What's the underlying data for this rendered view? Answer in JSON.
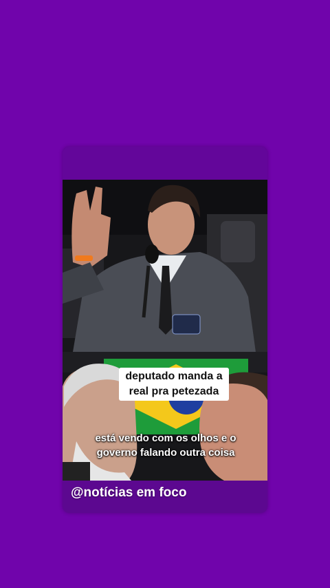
{
  "post": {
    "caption_top": "deputado manda a real pra petezada",
    "caption_bottom": "está vendo com os olhos e o governo falando outra coisa",
    "handle": "@notícias em foco"
  },
  "colors": {
    "background": "#7004ab",
    "card": "#5c0890",
    "caption_box": "#ffffff"
  }
}
